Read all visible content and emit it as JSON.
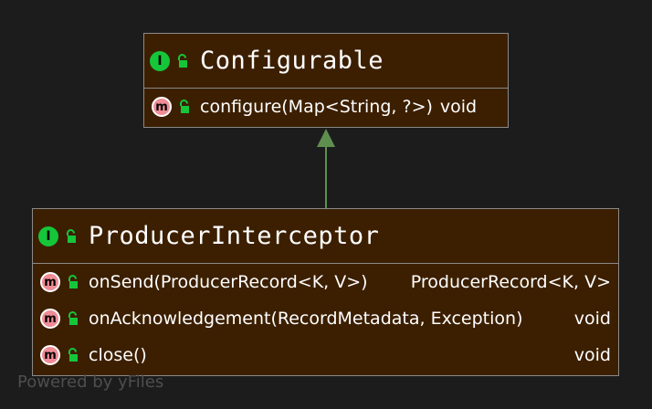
{
  "classes": {
    "configurable": {
      "badge": "I",
      "name": "Configurable",
      "methods": [
        {
          "badge": "m",
          "signature": "configure(Map<String, ?>)",
          "return_type": "void"
        }
      ]
    },
    "producer_interceptor": {
      "badge": "I",
      "name": "ProducerInterceptor",
      "methods": [
        {
          "badge": "m",
          "signature": "onSend(ProducerRecord<K, V>)",
          "return_type": "ProducerRecord<K, V>"
        },
        {
          "badge": "m",
          "signature": "onAcknowledgement(RecordMetadata, Exception)",
          "return_type": "void"
        },
        {
          "badge": "m",
          "signature": "close()",
          "return_type": "void"
        }
      ]
    }
  },
  "relations": [
    {
      "from": "ProducerInterceptor",
      "to": "Configurable",
      "kind": "extends"
    }
  ],
  "watermark": "Powered by yFiles",
  "colors": {
    "background": "#1c1c1c",
    "class_fill": "#3c1f00",
    "border": "#8a8a8a",
    "interface_badge": "#16c63a",
    "method_badge": "#f08c95",
    "arrow": "#5f8f4f"
  }
}
